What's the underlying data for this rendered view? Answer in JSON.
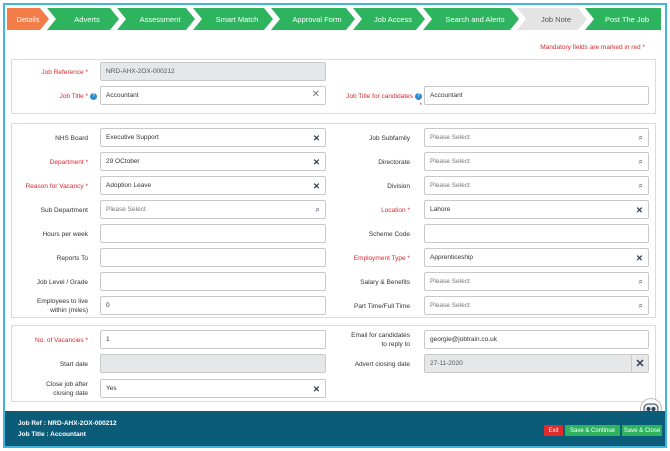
{
  "steps": [
    "Details",
    "Adverts",
    "Assessment",
    "Smart Match",
    "Approval Form",
    "Job Access",
    "Search and Alerts",
    "Job Note",
    "Post The Job"
  ],
  "mandatory_note": "Mandatory fields are marked in red *",
  "section1": {
    "job_reference": {
      "label": "Job Reference *",
      "value": "NRD-AHX-2OX-000212"
    },
    "job_title": {
      "label": "Job Title *",
      "value": "Accountant"
    },
    "job_title_candidates": {
      "label": "Job Title for candidates",
      "req": "*",
      "value": "Accountant"
    }
  },
  "section2": {
    "nhs_board": {
      "label": "NHS Board",
      "value": "Executive Support"
    },
    "department": {
      "label": "Department *",
      "value": "29 OCtober"
    },
    "reason_vacancy": {
      "label": "Reason for Vacancy *",
      "value": "Adoption Leave"
    },
    "sub_department": {
      "label": "Sub Department",
      "placeholder": "Please Select"
    },
    "hours_per_week": {
      "label": "Hours per week",
      "value": ""
    },
    "reports_to": {
      "label": "Reports To",
      "value": ""
    },
    "job_level": {
      "label": "Job Level / Grade",
      "value": ""
    },
    "employees_live": {
      "label1": "Employees to live",
      "label2": "within (miles)",
      "value": "0"
    },
    "job_subfamily": {
      "label": "Job Subfamily",
      "placeholder": "Please Select"
    },
    "directorate": {
      "label": "Directorate",
      "placeholder": "Please Select"
    },
    "division": {
      "label": "Division",
      "placeholder": "Please Select"
    },
    "location": {
      "label": "Location *",
      "value": "Lahore"
    },
    "scheme_code": {
      "label": "Scheme Code",
      "value": ""
    },
    "employment_type": {
      "label": "Employment Type *",
      "value": "Apprenticeship"
    },
    "salary_benefits": {
      "label": "Salary & Benefits",
      "placeholder": "Please Select"
    },
    "part_full_time": {
      "label": "Part Time/Full Time",
      "placeholder": "Please Select"
    }
  },
  "section3": {
    "vacancies": {
      "label": "No. of Vacancies *",
      "value": "1"
    },
    "start_date": {
      "label": "Start date",
      "value": ""
    },
    "close_job": {
      "label1": "Close job after",
      "label2": "closing date",
      "value": "Yes"
    },
    "email_candidates": {
      "label1": "Email for candidates",
      "label2": "to reply to",
      "value": "georgie@jobtrain.co.uk"
    },
    "advert_closing": {
      "label": "Advert closing date",
      "value": "27-11-2020"
    }
  },
  "footer": {
    "job_ref": "Job Ref : NRD-AHX-2OX-000212",
    "job_title": "Job Title : Accountant",
    "exit": "Exit",
    "save_continue": "Save & Continue",
    "save_close": "Save & Close"
  },
  "colors": {
    "accent_orange": "#f47c48",
    "step_green": "#2eb35e",
    "footer_blue": "#0b5c79",
    "required_red": "#d9292c"
  }
}
